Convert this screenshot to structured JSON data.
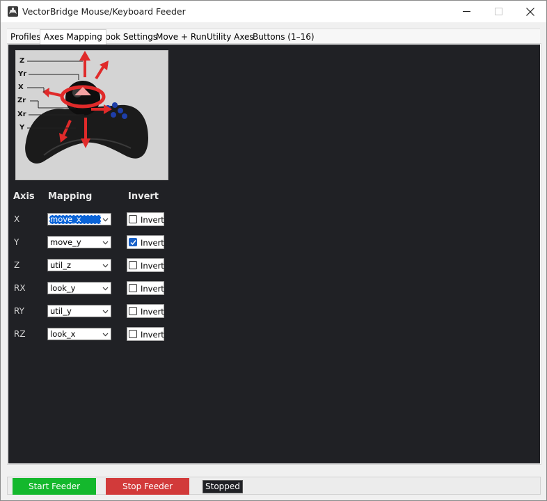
{
  "window": {
    "title": "VectorBridge Mouse/Keyboard Feeder",
    "icon": "app-gamepad-icon",
    "controls": [
      "minimize-icon",
      "maximize-icon",
      "close-icon"
    ]
  },
  "tabs": [
    {
      "label": "Profiles",
      "active": false
    },
    {
      "label": "Axes Mapping",
      "active": true
    },
    {
      "label": "Look Settings",
      "active": false
    },
    {
      "label": "Move + Run",
      "active": false
    },
    {
      "label": "Utility Axes",
      "active": false
    },
    {
      "label": "Buttons (1–16)",
      "active": false
    }
  ],
  "diagram": {
    "axis_labels": [
      "Z",
      "Yr",
      "X",
      "Zr",
      "Xr",
      "Y"
    ]
  },
  "table": {
    "headers": {
      "axis": "Axis",
      "mapping": "Mapping",
      "invert": "Invert"
    },
    "rows": [
      {
        "axis": "X",
        "mapping": "move_x",
        "invert_label": "Invert",
        "inverted": false,
        "focused": true
      },
      {
        "axis": "Y",
        "mapping": "move_y",
        "invert_label": "Invert",
        "inverted": true,
        "focused": false
      },
      {
        "axis": "Z",
        "mapping": "util_z",
        "invert_label": "Invert",
        "inverted": false,
        "focused": false
      },
      {
        "axis": "RX",
        "mapping": "look_y",
        "invert_label": "Invert",
        "inverted": false,
        "focused": false
      },
      {
        "axis": "RY",
        "mapping": "util_y",
        "invert_label": "Invert",
        "inverted": false,
        "focused": false
      },
      {
        "axis": "RZ",
        "mapping": "look_x",
        "invert_label": "Invert",
        "inverted": false,
        "focused": false
      }
    ]
  },
  "footer": {
    "start_label": "Start Feeder",
    "stop_label": "Stop Feeder",
    "status": "Stopped"
  },
  "colors": {
    "panel_bg": "#202125",
    "start_green": "#14b82d",
    "stop_red": "#d23a3a",
    "check_blue": "#1a62c8",
    "select_blue": "#0a64d8"
  }
}
